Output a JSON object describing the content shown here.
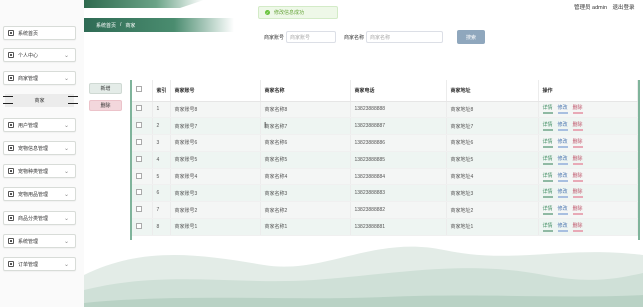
{
  "sidebar": {
    "items": [
      {
        "label": "系统首页",
        "icon": "home-icon",
        "has_chevron": false
      },
      {
        "label": "个人中心",
        "icon": "user-icon",
        "has_chevron": true
      },
      {
        "label": "商家管理",
        "icon": "shop-icon",
        "has_chevron": true
      },
      {
        "label": "用户管理",
        "icon": "users-icon",
        "has_chevron": true
      },
      {
        "label": "宠物信息管理",
        "icon": "pet-icon",
        "has_chevron": true
      },
      {
        "label": "宠物种类管理",
        "icon": "category-icon",
        "has_chevron": true
      },
      {
        "label": "宠物用品管理",
        "icon": "supplies-icon",
        "has_chevron": true
      },
      {
        "label": "商品分类管理",
        "icon": "goods-icon",
        "has_chevron": true
      },
      {
        "label": "系统管理",
        "icon": "settings-icon",
        "has_chevron": true
      },
      {
        "label": "订单管理",
        "icon": "order-icon",
        "has_chevron": true
      }
    ],
    "submenu_label": "商家"
  },
  "header": {
    "user_label": "管理员 admin",
    "logout_label": "退出登录",
    "breadcrumb": [
      "系统首页",
      "商家"
    ],
    "breadcrumb_sep": "/"
  },
  "toast": {
    "text": "修改信息成功",
    "color": "#67c23a"
  },
  "search": {
    "field1_label": "商家账号",
    "field1_placeholder": "商家账号",
    "field2_label": "商家名称",
    "field2_placeholder": "商家名称",
    "button_label": "搜索"
  },
  "actions": {
    "add_label": "新增",
    "delete_label": "删除"
  },
  "table": {
    "headers": [
      "索引",
      "商家账号",
      "商家名称",
      "商家电话",
      "商家地址",
      "操作"
    ],
    "row_actions": {
      "detail": "详情",
      "edit": "修改",
      "delete": "删除"
    },
    "rows": [
      {
        "index": "1",
        "account": "商家账号8",
        "name": "商家名称8",
        "phone": "13823888888",
        "address": "商家地址8"
      },
      {
        "index": "2",
        "account": "商家账号7",
        "name": "商家名称7",
        "phone": "13823888887",
        "address": "商家地址7"
      },
      {
        "index": "3",
        "account": "商家账号6",
        "name": "商家名称6",
        "phone": "13823888886",
        "address": "商家地址6"
      },
      {
        "index": "4",
        "account": "商家账号5",
        "name": "商家名称5",
        "phone": "13823888885",
        "address": "商家地址5"
      },
      {
        "index": "5",
        "account": "商家账号4",
        "name": "商家名称4",
        "phone": "13823888884",
        "address": "商家地址4"
      },
      {
        "index": "6",
        "account": "商家账号3",
        "name": "商家名称3",
        "phone": "13823888883",
        "address": "商家地址3"
      },
      {
        "index": "7",
        "account": "商家账号2",
        "name": "商家名称2",
        "phone": "13823888882",
        "address": "商家地址2"
      },
      {
        "index": "8",
        "account": "商家账号1",
        "name": "商家名称1",
        "phone": "13823888881",
        "address": "商家地址1"
      }
    ]
  },
  "colors": {
    "accent": "#3b7a5c",
    "search_button": "#8fa7bd",
    "delete": "#f3d7dc"
  }
}
